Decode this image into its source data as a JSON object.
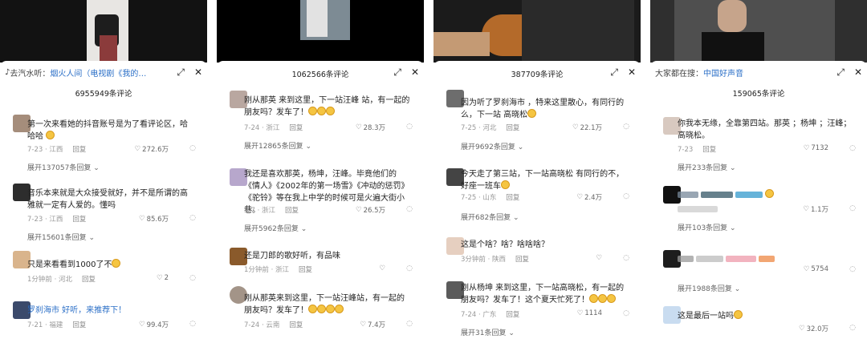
{
  "panels": [
    {
      "header_pre": "去汽水听：",
      "header_kw": "烟火人间（电视剧《我的人间烟...",
      "count": "6955949条评论",
      "comments": [
        {
          "text": "第一次来看她的抖音账号是为了看评论区，哈哈哈",
          "date": "7-23 · 江西",
          "reply": "回复",
          "likes": "272.6万",
          "expand": "展开137057条回复"
        },
        {
          "text": "音乐本来就是大众接受就好，并不是所谓的高雅就一定有人爱的。懂吗",
          "date": "7-23 · 江西",
          "reply": "回复",
          "likes": "85.6万",
          "expand": "展开15601条回复"
        },
        {
          "text": "只是来看看到1000了不",
          "date": "1分钟前 · 河北",
          "reply": "回复",
          "likes": "2",
          "expand": ""
        },
        {
          "text": "罗刹海市 好听，来推荐下！",
          "date": "7-21 · 福建",
          "reply": "回复",
          "likes": "99.4万",
          "expand": ""
        }
      ]
    },
    {
      "header_pre": "",
      "header_kw": "",
      "count": "1062566条评论",
      "comments": [
        {
          "text": "刚从那英 来到这里，下一站汪峰 站，有一起的朋友吗？发车了！",
          "date": "7-24 · 浙江",
          "reply": "回复",
          "likes": "28.3万",
          "expand": "展开12865条回复"
        },
        {
          "text": "我还是喜欢那英，杨坤，汪峰。毕竟他们的《情人》《2002年的第一场雪》《冲动的惩罚》《驼铃》等在我上中学的时候可是火遍大街小巷。",
          "date": "5-7 · 浙江",
          "reply": "回复",
          "likes": "26.5万",
          "expand": "展开5962条回复"
        },
        {
          "text": "还是刀郎的歌好听，有品味",
          "date": "1分钟前 · 浙江",
          "reply": "回复",
          "likes": "",
          "expand": ""
        },
        {
          "text": "刚从那英来到这里，下一站汪峰站，有一起的朋友吗？发车了！",
          "date": "7-24 · 云南",
          "reply": "回复",
          "likes": "7.4万",
          "expand": ""
        }
      ]
    },
    {
      "header_pre": "",
      "header_kw": "",
      "count": "387709条评论",
      "comments": [
        {
          "text": "因为听了罗刹海市 ，特来这里散心，有同行的么，下一站 高晓松",
          "date": "7-25 · 河北",
          "reply": "回复",
          "likes": "22.1万",
          "expand": "展开9692条回复"
        },
        {
          "text": "今天走了第三站，下一站高晓松 有同行的不，好座一班车",
          "date": "7-25 · 山东",
          "reply": "回复",
          "likes": "2.4万",
          "expand": "展开682条回复"
        },
        {
          "text": "这是个啥？啥？啥啥啥？",
          "date": "3分钟前 · 陕西",
          "reply": "回复",
          "likes": "",
          "expand": ""
        },
        {
          "text": "刚从杨坤 来到这里，下一站高晓松，有一起的朋友吗？发车了！这个夏天忙死了！",
          "date": "7-24 · 广东",
          "reply": "回复",
          "likes": "1114",
          "expand": "展开31条回复"
        }
      ]
    },
    {
      "header_pre": "大家都在搜：",
      "header_kw": "中国好声音",
      "count": "159065条评论",
      "comments": [
        {
          "text": "你我本无缘，全靠第四站。那英 ；杨坤 ；汪峰；高晓松。",
          "date": "7-23",
          "reply": "回复",
          "likes": "7132",
          "expand": "展开233条回复"
        },
        {
          "text": "",
          "date": "",
          "reply": "",
          "likes": "1.1万",
          "expand": "展开103条回复"
        },
        {
          "text": "",
          "date": "",
          "reply": "",
          "likes": "5754",
          "expand": "展开1988条回复"
        },
        {
          "text": "这是最后一站吗",
          "date": "",
          "reply": "回复",
          "likes": "32.0万",
          "expand": ""
        }
      ]
    }
  ]
}
